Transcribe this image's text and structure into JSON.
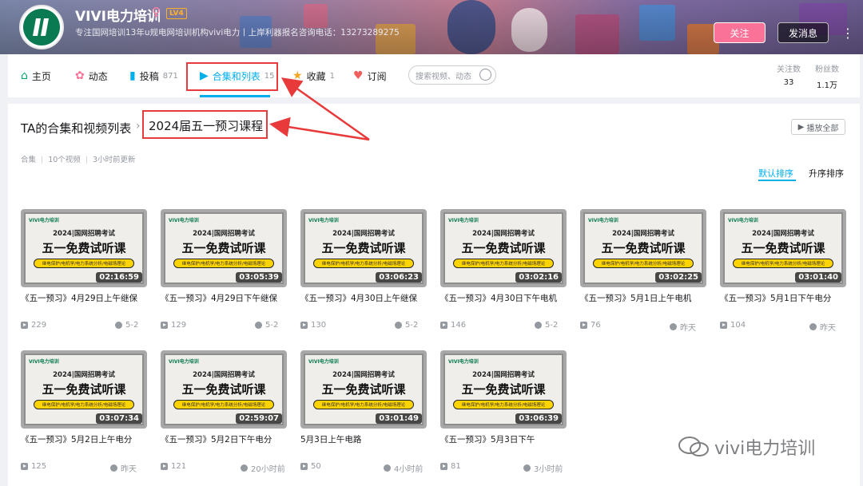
{
  "profile": {
    "username": "VIVI电力培训",
    "gender_symbol": "♀",
    "level": "LV4",
    "sign": "专注国网培训13年u规电网培训机构vivi电力丨上岸利器报名咨询电话：13273289275",
    "follow_label": "关注",
    "message_label": "发消息",
    "more_label": "⋮"
  },
  "nav": {
    "items": [
      {
        "label": "主页",
        "icon": "home-icon",
        "count": ""
      },
      {
        "label": "动态",
        "icon": "activity-icon",
        "count": ""
      },
      {
        "label": "投稿",
        "icon": "upload-icon",
        "count": "871"
      },
      {
        "label": "合集和列表",
        "icon": "collection-icon",
        "count": "15"
      },
      {
        "label": "收藏",
        "icon": "star-icon",
        "count": "1"
      },
      {
        "label": "订阅",
        "icon": "heart-icon",
        "count": ""
      }
    ],
    "search_placeholder": "搜索视频、动态",
    "stats": [
      {
        "label": "关注数",
        "value": "33"
      },
      {
        "label": "粉丝数",
        "value": "1.1万"
      }
    ]
  },
  "collection": {
    "breadcrumb_root": "TA的合集和视频列表",
    "breadcrumb_sep": "›",
    "title": "2024届五一预习课程",
    "play_all": "播放全部",
    "meta_type": "合集",
    "meta_count": "10个视频",
    "meta_updated": "3小时前更新",
    "sort_default": "默认排序",
    "sort_asc": "升序排序"
  },
  "thumbnail": {
    "logo": "VIVI电力培训",
    "line1": "2024|国网招聘考试",
    "line2": "五一免费试听课",
    "line3": "继电保护/电机学/电力系统分析/电磁场理论"
  },
  "videos": [
    {
      "duration": "02:16:59",
      "title": "《五一预习》4月29日上午继保",
      "plays": "229",
      "date": "5-2"
    },
    {
      "duration": "03:05:39",
      "title": "《五一预习》4月29日下午继保",
      "plays": "129",
      "date": "5-2"
    },
    {
      "duration": "03:06:23",
      "title": "《五一预习》4月30日上午继保",
      "plays": "130",
      "date": "5-2"
    },
    {
      "duration": "03:02:16",
      "title": "《五一预习》4月30日下午电机",
      "plays": "146",
      "date": "5-2"
    },
    {
      "duration": "03:02:25",
      "title": "《五一预习》5月1日上午电机",
      "plays": "76",
      "date": "昨天"
    },
    {
      "duration": "03:01:40",
      "title": "《五一预习》5月1日下午电分",
      "plays": "104",
      "date": "昨天"
    },
    {
      "duration": "03:07:34",
      "title": "《五一预习》5月2日上午电分",
      "plays": "125",
      "date": "昨天"
    },
    {
      "duration": "02:59:07",
      "title": "《五一预习》5月2日下午电分",
      "plays": "121",
      "date": "20小时前"
    },
    {
      "duration": "03:01:49",
      "title": "5月3日上午电路",
      "plays": "50",
      "date": "4小时前"
    },
    {
      "duration": "03:06:39",
      "title": "《五一预习》5月3日下午",
      "plays": "81",
      "date": "3小时前"
    }
  ],
  "watermark": "vivi电力培训",
  "colors": {
    "accent": "#00aeec",
    "follow": "#fb7299",
    "annotation": "#e83a3a"
  }
}
